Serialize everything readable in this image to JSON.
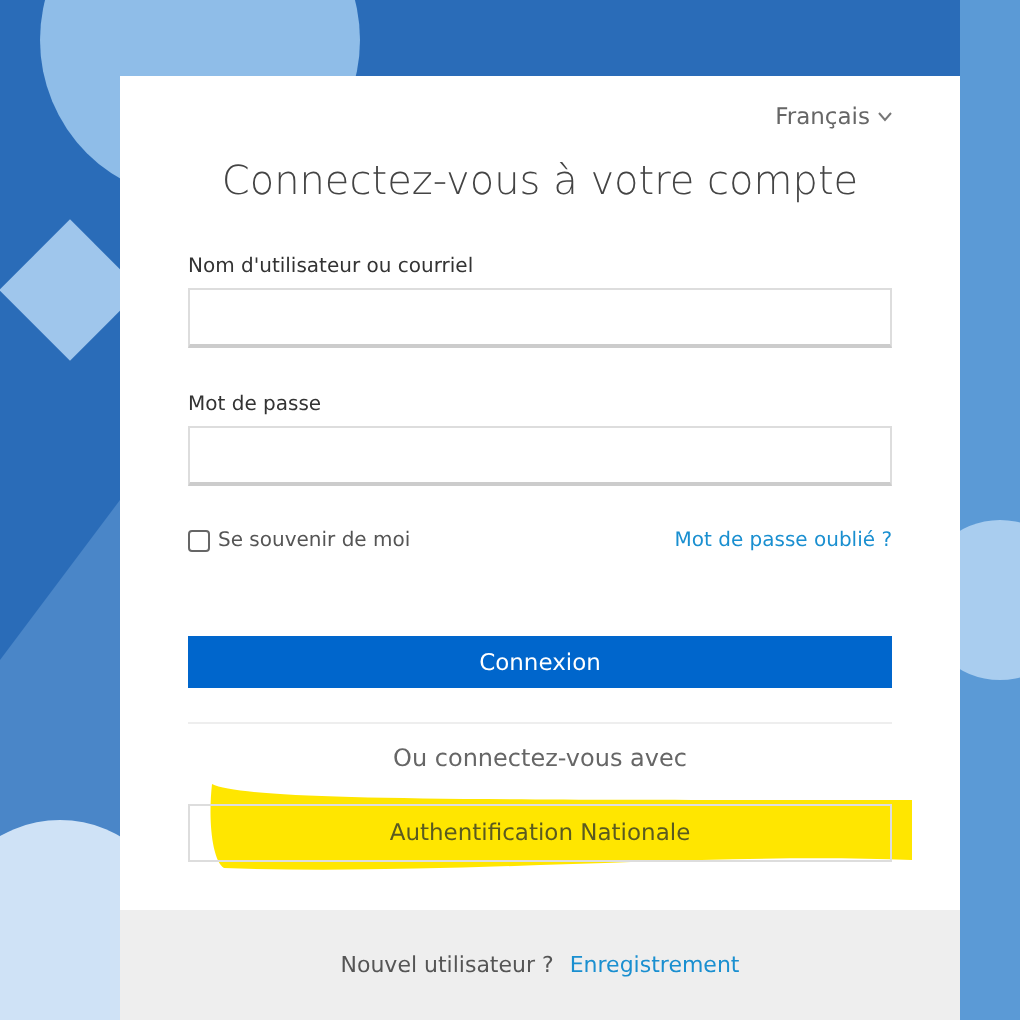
{
  "language": {
    "label": "Français"
  },
  "title": "Connectez-vous à votre compte",
  "fields": [
    {
      "label": "Nom d'utilisateur ou courriel"
    },
    {
      "label": "Mot de passe"
    }
  ],
  "remember": {
    "label": "Se souvenir de moi",
    "checked": false
  },
  "forgot_link": "Mot de passe oublié ?",
  "login_button": "Connexion",
  "divider_text": "Ou connectez-vous avec",
  "providers": [
    {
      "label": "Authentification Nationale",
      "highlighted": true
    }
  ],
  "footer": {
    "question": "Nouvel utilisateur ?",
    "link": "Enregistrement"
  }
}
